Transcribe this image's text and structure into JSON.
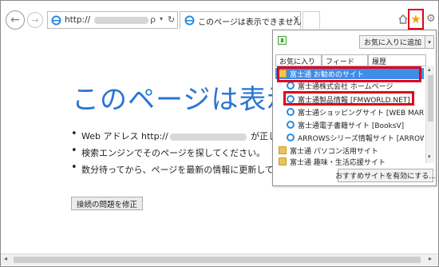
{
  "colors": {
    "accent": "#2a76d2",
    "highlight": "#e0001a",
    "selection": "#3e8de6"
  },
  "icons": {
    "back": "back-arrow-icon",
    "forward": "forward-arrow-icon",
    "ie": "ie-logo-icon",
    "search": "search-icon",
    "refresh": "refresh-icon",
    "close": "close-icon",
    "home": "home-icon",
    "favorites": "star-icon",
    "settings": "gear-icon",
    "folder": "folder-icon",
    "pin": "pin-icon"
  },
  "address_bar": {
    "url_prefix": "http://",
    "search_glyph": "ρ",
    "dropdown_glyph": "▾",
    "refresh_glyph": "↻"
  },
  "tab": {
    "title": "このページは表示できません",
    "close": "×"
  },
  "toolbar": {
    "back_glyph": "←",
    "forward_glyph": "→",
    "star_glyph": "★",
    "gear_glyph": "⚙"
  },
  "page": {
    "headline": "このページは表示で",
    "bullets": [
      {
        "before": "Web アドレス http://",
        "after": " が正しいか"
      },
      {
        "text": "検索エンジンでそのページを探してください。"
      },
      {
        "text": "数分待ってから、ページを最新の情報に更新してください"
      }
    ],
    "fix_button": "接続の問題を修正"
  },
  "favorites_panel": {
    "add_button": "お気に入りに追加",
    "add_dropdown": "▾",
    "tabs": [
      "お気に入り",
      "フィード",
      "履歴"
    ],
    "items": [
      {
        "label": "富士通 お勧めのサイト",
        "icon": "folder-icon",
        "indent": 0,
        "selected": true
      },
      {
        "label": "富士通株式会社 ホームページ",
        "icon": "ie-logo-icon",
        "indent": 1,
        "selected": false
      },
      {
        "label": "富士通製品情報 [FMWORLD.NET]",
        "icon": "ie-logo-icon",
        "indent": 1,
        "selected": false
      },
      {
        "label": "富士通ショッピングサイト [WEB MART]",
        "icon": "ie-logo-icon",
        "indent": 1,
        "selected": false
      },
      {
        "label": "富士通電子書籍サイト [BooksV]",
        "icon": "ie-logo-icon",
        "indent": 1,
        "selected": false
      },
      {
        "label": "ARROWSシリーズ情報サイト [ARROW…",
        "icon": "ie-logo-icon",
        "indent": 1,
        "selected": false
      },
      {
        "label": "富士通 パソコン活用サイト",
        "icon": "folder-icon",
        "indent": 0,
        "selected": false
      },
      {
        "label": "富士通 趣味・生活応援サイト",
        "icon": "folder-icon",
        "indent": 0,
        "selected": false
      }
    ],
    "scroll_up": "▴",
    "scroll_down": "▾",
    "enable_button": "おすすめサイトを有効にする..."
  },
  "hscroll": {
    "left": "◂",
    "right": "▸"
  }
}
